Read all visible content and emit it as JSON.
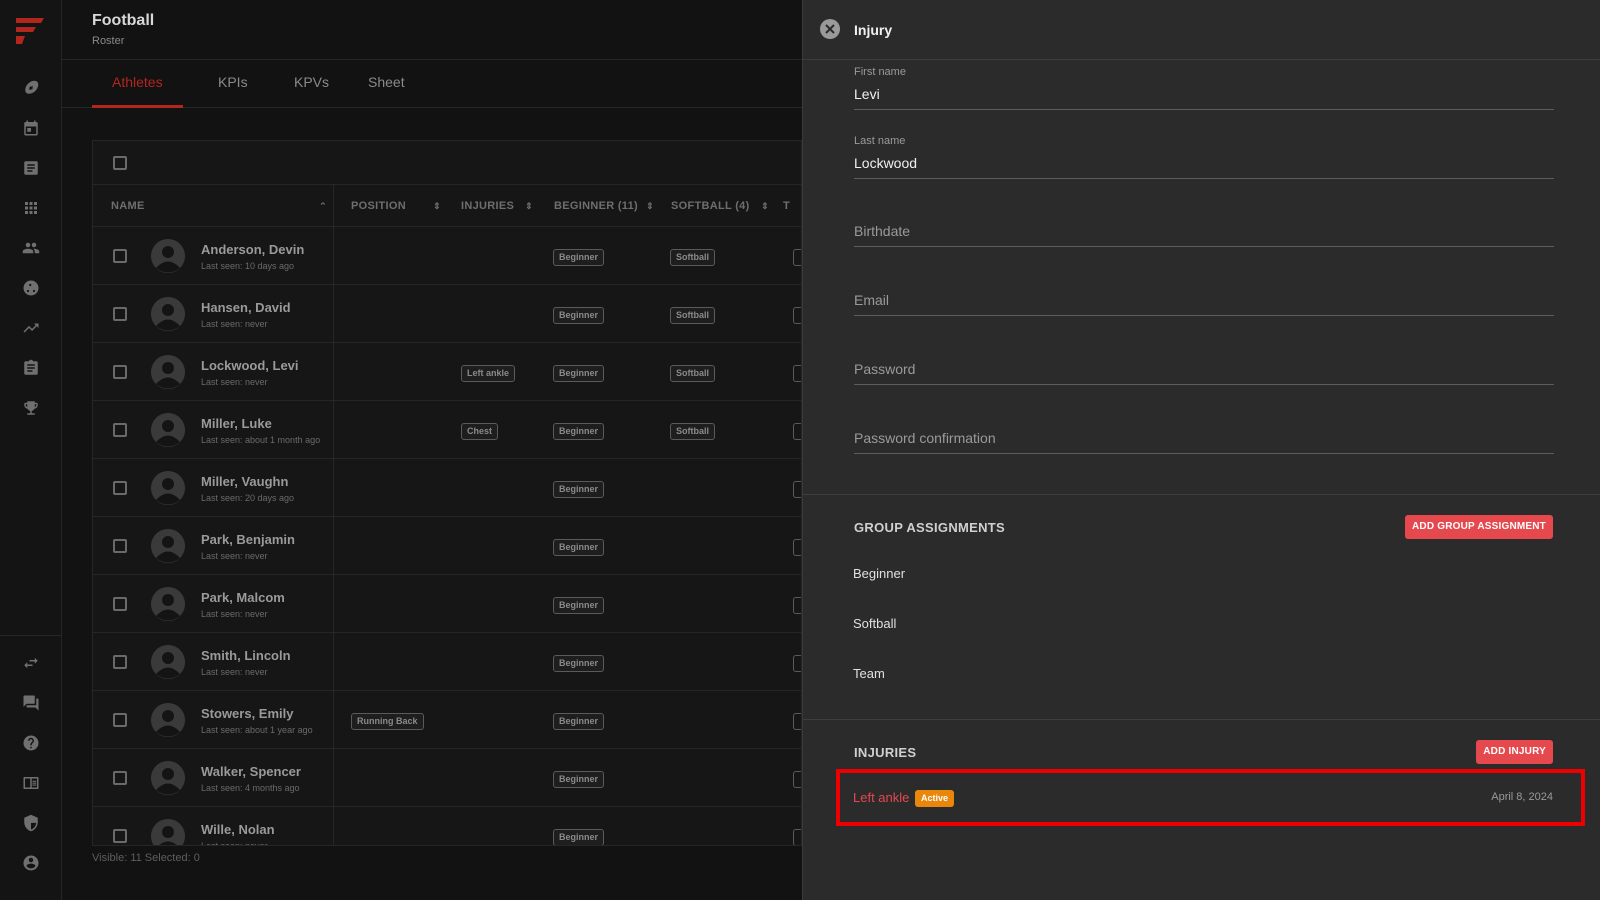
{
  "app": {
    "title": "Football",
    "subtitle": "Roster",
    "brand_color": "#b3261e",
    "accent_color": "#e5484d"
  },
  "sidebar": {
    "items": [
      {
        "icon": "football-icon"
      },
      {
        "icon": "calendar-icon"
      },
      {
        "icon": "notes-icon"
      },
      {
        "icon": "grid-icon"
      },
      {
        "icon": "people-icon"
      },
      {
        "icon": "teams-icon"
      },
      {
        "icon": "trending-icon"
      },
      {
        "icon": "clipboard-icon"
      },
      {
        "icon": "trophy-icon"
      },
      {
        "icon": "swap-icon"
      },
      {
        "icon": "chat-icon"
      },
      {
        "icon": "help-icon"
      },
      {
        "icon": "book-icon"
      },
      {
        "icon": "shield-icon"
      },
      {
        "icon": "account-icon"
      }
    ]
  },
  "tabs": [
    {
      "label": "Athletes",
      "active": true
    },
    {
      "label": "KPIs",
      "active": false
    },
    {
      "label": "KPVs",
      "active": false
    },
    {
      "label": "Sheet",
      "active": false
    }
  ],
  "table": {
    "columns": [
      "NAME",
      "POSITION",
      "INJURIES",
      "BEGINNER (11)",
      "SOFTBALL (4)",
      "T"
    ],
    "rows": [
      {
        "name": "Anderson, Devin",
        "last_seen": "Last seen: 10 days ago",
        "position": "",
        "injury": "",
        "beginner": "Beginner",
        "softball": "Softball"
      },
      {
        "name": "Hansen, David",
        "last_seen": "Last seen: never",
        "position": "",
        "injury": "",
        "beginner": "Beginner",
        "softball": "Softball"
      },
      {
        "name": "Lockwood, Levi",
        "last_seen": "Last seen: never",
        "position": "",
        "injury": "Left ankle",
        "beginner": "Beginner",
        "softball": "Softball"
      },
      {
        "name": "Miller, Luke",
        "last_seen": "Last seen: about 1 month ago",
        "position": "",
        "injury": "Chest",
        "beginner": "Beginner",
        "softball": "Softball"
      },
      {
        "name": "Miller, Vaughn",
        "last_seen": "Last seen: 20 days ago",
        "position": "",
        "injury": "",
        "beginner": "Beginner",
        "softball": ""
      },
      {
        "name": "Park, Benjamin",
        "last_seen": "Last seen: never",
        "position": "",
        "injury": "",
        "beginner": "Beginner",
        "softball": ""
      },
      {
        "name": "Park, Malcom",
        "last_seen": "Last seen: never",
        "position": "",
        "injury": "",
        "beginner": "Beginner",
        "softball": ""
      },
      {
        "name": "Smith, Lincoln",
        "last_seen": "Last seen: never",
        "position": "",
        "injury": "",
        "beginner": "Beginner",
        "softball": ""
      },
      {
        "name": "Stowers, Emily",
        "last_seen": "Last seen: about 1 year ago",
        "position": "Running Back",
        "injury": "",
        "beginner": "Beginner",
        "softball": ""
      },
      {
        "name": "Walker, Spencer",
        "last_seen": "Last seen: 4 months ago",
        "position": "",
        "injury": "",
        "beginner": "Beginner",
        "softball": ""
      },
      {
        "name": "Wille, Nolan",
        "last_seen": "Last seen: never",
        "position": "",
        "injury": "",
        "beginner": "Beginner",
        "softball": ""
      }
    ],
    "footer": "Visible: 11   Selected: 0"
  },
  "panel": {
    "title": "Injury",
    "fields": {
      "first_name_label": "First name",
      "first_name_value": "Levi",
      "last_name_label": "Last name",
      "last_name_value": "Lockwood",
      "birthdate_placeholder": "Birthdate",
      "email_placeholder": "Email",
      "password_placeholder": "Password",
      "password_confirmation_placeholder": "Password confirmation"
    },
    "group_assignments": {
      "title": "GROUP ASSIGNMENTS",
      "add_label": "ADD GROUP ASSIGNMENT",
      "items": [
        "Beginner",
        "Softball",
        "Team"
      ]
    },
    "injuries": {
      "title": "INJURIES",
      "add_label": "ADD INJURY",
      "items": [
        {
          "name": "Left ankle",
          "status": "Active",
          "date": "April 8, 2024"
        }
      ]
    }
  }
}
